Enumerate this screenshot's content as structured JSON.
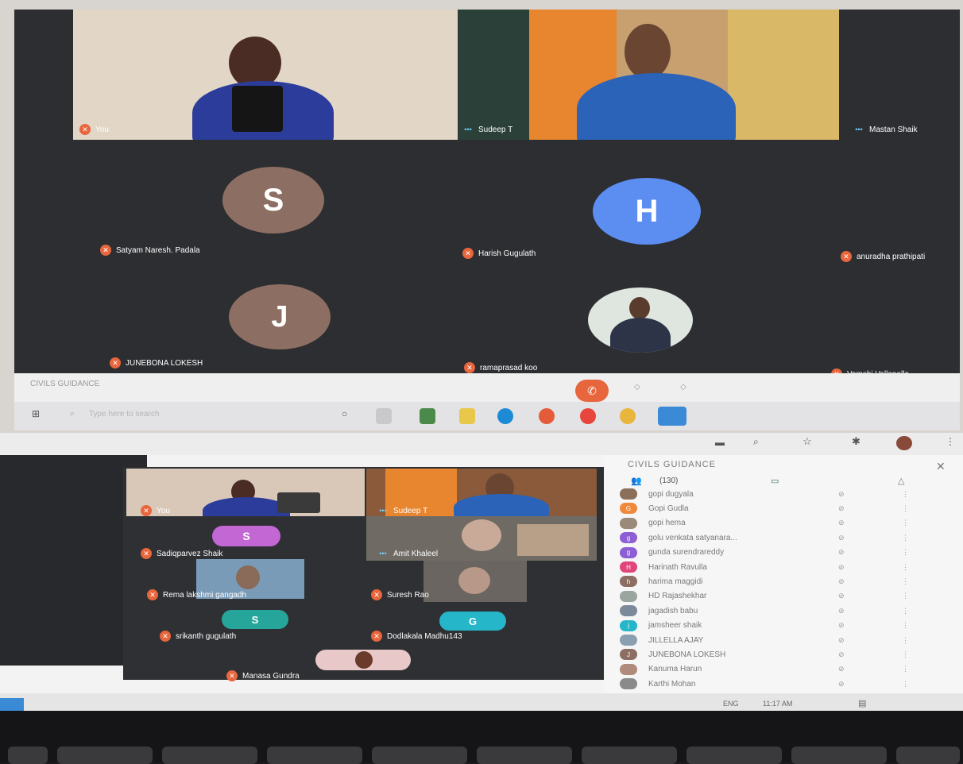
{
  "top_meeting": {
    "tiles": [
      {
        "name": "You"
      },
      {
        "name": "Sudeep T"
      },
      {
        "name": "Mastan Shaik"
      },
      {
        "name": "Satyam Naresh. Padala",
        "initial": "S",
        "color": "#8d6e63"
      },
      {
        "name": "Harish Gugulath",
        "initial": "H",
        "color": "#5c8ef2"
      },
      {
        "name": "anuradha prathipati"
      },
      {
        "name": "JUNEBONA LOKESH",
        "initial": "J",
        "color": "#8d6e63"
      },
      {
        "name": "ramaprasad koo"
      },
      {
        "name": "Vamshi Vallapalla"
      }
    ],
    "meeting_bar_title": "CIVILS GUIDANCE",
    "search_placeholder": "Type here to search"
  },
  "bottom_meeting": {
    "tiles": [
      {
        "name": "You"
      },
      {
        "name": "Sudeep T"
      },
      {
        "name": "Sadiqparvez Shaik",
        "initial": "S",
        "color": "#c267d4"
      },
      {
        "name": "Amit Khaleel"
      },
      {
        "name": "Rema lakshmi gangadh"
      },
      {
        "name": "Suresh Rao"
      },
      {
        "name": "srikanth gugulath",
        "initial": "S",
        "color": "#26a69a"
      },
      {
        "name": "Dodlakala Madhu143",
        "initial": "G",
        "color": "#26b6c9"
      },
      {
        "name": "Manasa Gundra"
      }
    ]
  },
  "panel": {
    "title": "CIVILS GUIDANCE",
    "count": "(130)",
    "participants": [
      {
        "name": "gopi dugyala",
        "initial": "",
        "color": "#8a6f5a"
      },
      {
        "name": "Gopi Gudla",
        "initial": "G",
        "color": "#ef8a3c"
      },
      {
        "name": "gopi hema",
        "initial": "",
        "color": "#9b8a7a"
      },
      {
        "name": "golu venkata satyanara...",
        "initial": "g",
        "color": "#8e5fd4"
      },
      {
        "name": "gunda surendrareddy",
        "initial": "g",
        "color": "#8e5fd4"
      },
      {
        "name": "Harinath Ravulla",
        "initial": "H",
        "color": "#e0457b"
      },
      {
        "name": "harima maggidi",
        "initial": "h",
        "color": "#8d6e63"
      },
      {
        "name": "HD Rajashekhar",
        "initial": "",
        "color": "#9aa5a0"
      },
      {
        "name": "jagadish babu",
        "initial": "",
        "color": "#7a8a9a"
      },
      {
        "name": "jamsheer shaik",
        "initial": "j",
        "color": "#26b6c9"
      },
      {
        "name": "JILLELLA AJAY",
        "initial": "",
        "color": "#8aa0b0"
      },
      {
        "name": "JUNEBONA LOKESH",
        "initial": "J",
        "color": "#8d6e63"
      },
      {
        "name": "Kanuma Harun",
        "initial": "",
        "color": "#b08a7a"
      },
      {
        "name": "Karthi Mohan",
        "initial": "",
        "color": "#8a8a8a"
      }
    ]
  },
  "taskbar": {
    "time": "11:17 AM",
    "lang": "ENG"
  },
  "colors": {
    "meet_bg": "#2c2e31",
    "end_call": "#e8663d"
  }
}
